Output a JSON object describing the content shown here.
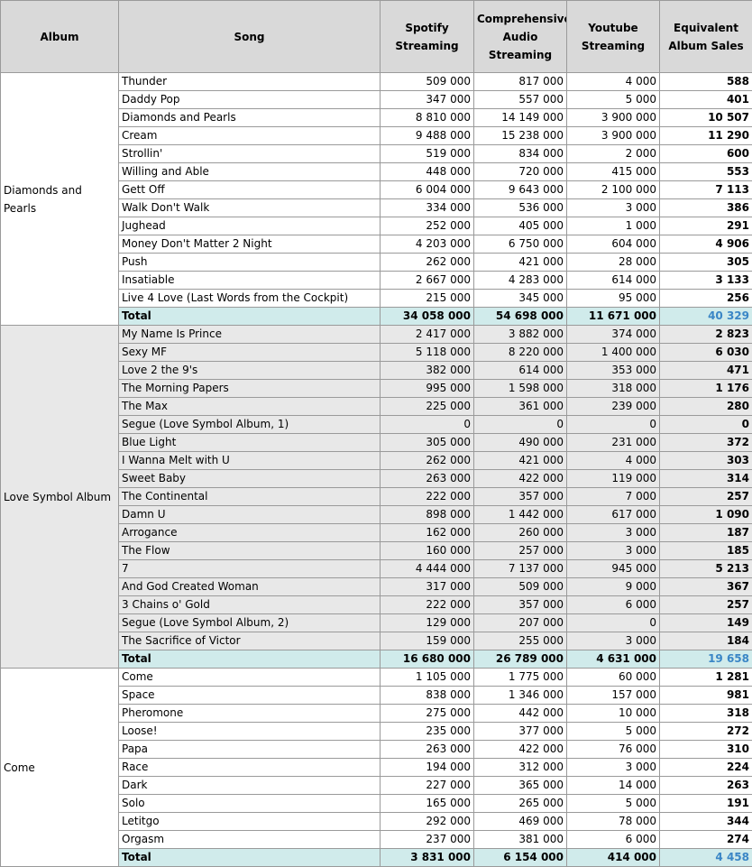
{
  "headers": {
    "album": "Album",
    "song": "Song",
    "spotify": "Spotify Streaming",
    "comprehensive": "Comprehensive Audio Streaming",
    "youtube": "Youtube Streaming",
    "equivalent": "Equivalent Album Sales"
  },
  "groups": [
    {
      "album": "Diamonds and Pearls",
      "shade": "white",
      "rows": [
        [
          "Thunder",
          "509 000",
          "817 000",
          "4 000",
          "588"
        ],
        [
          "Daddy Pop",
          "347 000",
          "557 000",
          "5 000",
          "401"
        ],
        [
          "Diamonds and Pearls",
          "8 810 000",
          "14 149 000",
          "3 900 000",
          "10 507"
        ],
        [
          "Cream",
          "9 488 000",
          "15 238 000",
          "3 900 000",
          "11 290"
        ],
        [
          "Strollin'",
          "519 000",
          "834 000",
          "2 000",
          "600"
        ],
        [
          "Willing and Able",
          "448 000",
          "720 000",
          "415 000",
          "553"
        ],
        [
          "Gett Off",
          "6 004 000",
          "9 643 000",
          "2 100 000",
          "7 113"
        ],
        [
          "Walk Don't Walk",
          "334 000",
          "536 000",
          "3 000",
          "386"
        ],
        [
          "Jughead",
          "252 000",
          "405 000",
          "1 000",
          "291"
        ],
        [
          "Money Don't Matter 2 Night",
          "4 203 000",
          "6 750 000",
          "604 000",
          "4 906"
        ],
        [
          "Push",
          "262 000",
          "421 000",
          "28 000",
          "305"
        ],
        [
          "Insatiable",
          "2 667 000",
          "4 283 000",
          "614 000",
          "3 133"
        ],
        [
          "Live 4 Love (Last Words from the Cockpit)",
          "215 000",
          "345 000",
          "95 000",
          "256"
        ]
      ],
      "total": [
        "Total",
        "34 058 000",
        "54 698 000",
        "11 671 000",
        "40 329"
      ]
    },
    {
      "album": "Love Symbol Album",
      "shade": "grey",
      "rows": [
        [
          "My Name Is Prince",
          "2 417 000",
          "3 882 000",
          "374 000",
          "2 823"
        ],
        [
          "Sexy MF",
          "5 118 000",
          "8 220 000",
          "1 400 000",
          "6 030"
        ],
        [
          "Love 2 the 9's",
          "382 000",
          "614 000",
          "353 000",
          "471"
        ],
        [
          "The Morning Papers",
          "995 000",
          "1 598 000",
          "318 000",
          "1 176"
        ],
        [
          "The Max",
          "225 000",
          "361 000",
          "239 000",
          "280"
        ],
        [
          "Segue (Love Symbol Album, 1)",
          "0",
          "0",
          "0",
          "0"
        ],
        [
          "Blue Light",
          "305 000",
          "490 000",
          "231 000",
          "372"
        ],
        [
          "I Wanna Melt with U",
          "262 000",
          "421 000",
          "4 000",
          "303"
        ],
        [
          "Sweet Baby",
          "263 000",
          "422 000",
          "119 000",
          "314"
        ],
        [
          "The Continental",
          "222 000",
          "357 000",
          "7 000",
          "257"
        ],
        [
          "Damn U",
          "898 000",
          "1 442 000",
          "617 000",
          "1 090"
        ],
        [
          "Arrogance",
          "162 000",
          "260 000",
          "3 000",
          "187"
        ],
        [
          "The Flow",
          "160 000",
          "257 000",
          "3 000",
          "185"
        ],
        [
          "7",
          "4 444 000",
          "7 137 000",
          "945 000",
          "5 213"
        ],
        [
          "And God Created Woman",
          "317 000",
          "509 000",
          "9 000",
          "367"
        ],
        [
          "3 Chains o' Gold",
          "222 000",
          "357 000",
          "6 000",
          "257"
        ],
        [
          "Segue (Love Symbol Album, 2)",
          "129 000",
          "207 000",
          "0",
          "149"
        ],
        [
          "The Sacrifice of Victor",
          "159 000",
          "255 000",
          "3 000",
          "184"
        ]
      ],
      "total": [
        "Total",
        "16 680 000",
        "26 789 000",
        "4 631 000",
        "19 658"
      ]
    },
    {
      "album": "Come",
      "shade": "white",
      "rows": [
        [
          "Come",
          "1 105 000",
          "1 775 000",
          "60 000",
          "1 281"
        ],
        [
          "Space",
          "838 000",
          "1 346 000",
          "157 000",
          "981"
        ],
        [
          "Pheromone",
          "275 000",
          "442 000",
          "10 000",
          "318"
        ],
        [
          "Loose!",
          "235 000",
          "377 000",
          "5 000",
          "272"
        ],
        [
          "Papa",
          "263 000",
          "422 000",
          "76 000",
          "310"
        ],
        [
          "Race",
          "194 000",
          "312 000",
          "3 000",
          "224"
        ],
        [
          "Dark",
          "227 000",
          "365 000",
          "14 000",
          "263"
        ],
        [
          "Solo",
          "165 000",
          "265 000",
          "5 000",
          "191"
        ],
        [
          "Letitgo",
          "292 000",
          "469 000",
          "78 000",
          "344"
        ],
        [
          "Orgasm",
          "237 000",
          "381 000",
          "6 000",
          "274"
        ]
      ],
      "total": [
        "Total",
        "3 831 000",
        "6 154 000",
        "414 000",
        "4 458"
      ]
    }
  ]
}
